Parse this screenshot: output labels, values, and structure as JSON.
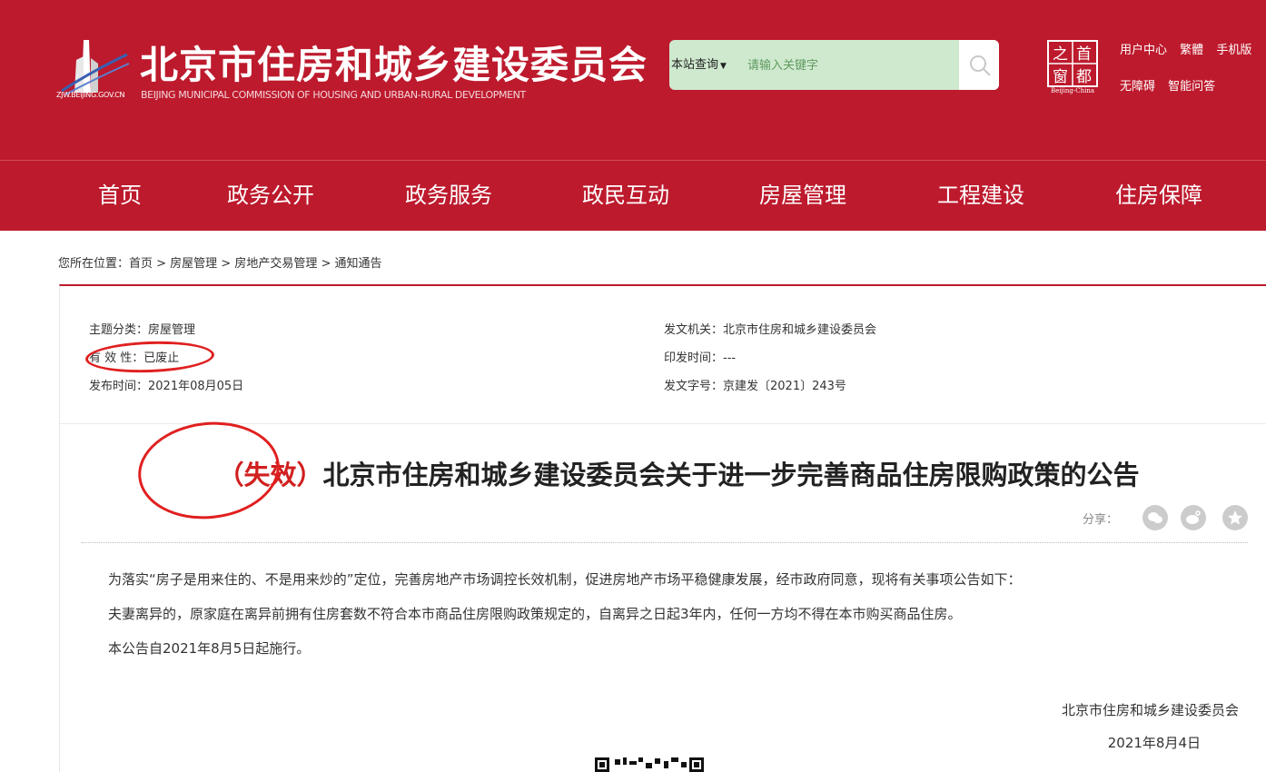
{
  "header": {
    "logo_url": "ZJW.BEIJING.GOV.CN",
    "site_title": "北京市住房和城乡建设委员会",
    "site_subtitle": "BEIJING MUNICIPAL COMMISSION OF HOUSING AND URBAN-RURAL DEVELOPMENT",
    "search_scope": "本站查询",
    "search_placeholder": "请输入关键字",
    "capital_logo_chars": [
      "之",
      "首",
      "窗",
      "都"
    ],
    "capital_logo_sub": "Beijing-China",
    "top_links_row1": [
      "用户中心",
      "繁體",
      "手机版"
    ],
    "top_links_row2": [
      "无障碍",
      "智能问答"
    ],
    "colors": {
      "brand_red": "#bd1a2d",
      "search_bg": "#cfe9cf"
    }
  },
  "nav": [
    "首页",
    "政务公开",
    "政务服务",
    "政民互动",
    "房屋管理",
    "工程建设",
    "住房保障"
  ],
  "breadcrumb": "您所在位置：首页 > 房屋管理 > 房地产交易管理 > 通知通告",
  "meta": {
    "topic": "主题分类：房屋管理",
    "validity": "有 效 性：已废止",
    "publish_date": "发布时间：2021年08月05日",
    "issuer": "发文机关：北京市住房和城乡建设委员会",
    "print_date": "印发时间：---",
    "doc_number": "发文字号：京建发〔2021〕243号"
  },
  "article": {
    "title_prefix": "（失效）",
    "title_main": "北京市住房和城乡建设委员会关于进一步完善商品住房限购政策的公告",
    "share_label": "分享：",
    "share_icons": [
      "wechat-icon",
      "weibo-icon",
      "favorite-icon"
    ],
    "paragraphs": [
      "为落实“房子是用来住的、不是用来炒的”定位，完善房地产市场调控长效机制，促进房地产市场平稳健康发展，经市政府同意，现将有关事项公告如下：",
      "夫妻离异的，原家庭在离异前拥有住房套数不符合本市商品住房限购政策规定的，自离异之日起3年内，任何一方均不得在本市购买商品住房。",
      "本公告自2021年8月5日起施行。"
    ],
    "signature_org": "北京市住房和城乡建设委员会",
    "signature_date": "2021年8月4日",
    "annotation_color": "#e02020"
  }
}
